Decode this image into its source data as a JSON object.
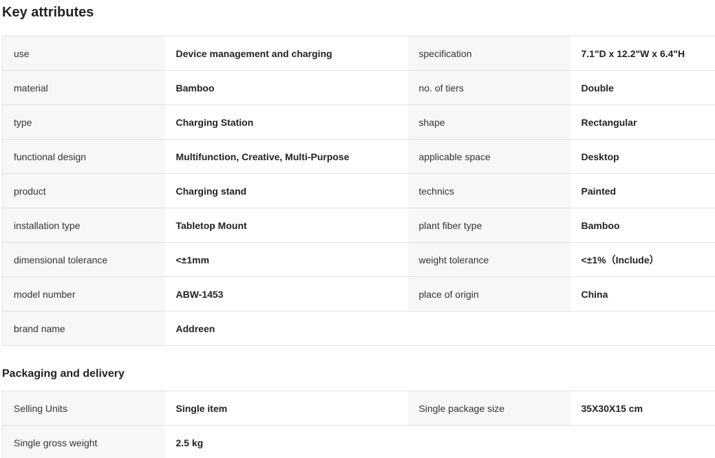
{
  "key_attributes": {
    "title": "Key attributes",
    "rows": [
      [
        {
          "name": "use",
          "value": "Device management and charging"
        },
        {
          "name": "specification",
          "value": "7.1\"D x 12.2\"W x 6.4\"H"
        }
      ],
      [
        {
          "name": "material",
          "value": "Bamboo"
        },
        {
          "name": "no. of tiers",
          "value": "Double"
        }
      ],
      [
        {
          "name": "type",
          "value": "Charging Station"
        },
        {
          "name": "shape",
          "value": "Rectangular"
        }
      ],
      [
        {
          "name": "functional design",
          "value": "Multifunction, Creative, Multi-Purpose"
        },
        {
          "name": "applicable space",
          "value": "Desktop"
        }
      ],
      [
        {
          "name": "product",
          "value": "Charging stand"
        },
        {
          "name": "technics",
          "value": "Painted"
        }
      ],
      [
        {
          "name": "installation type",
          "value": "Tabletop Mount"
        },
        {
          "name": "plant fiber type",
          "value": "Bamboo"
        }
      ],
      [
        {
          "name": "dimensional tolerance",
          "value": "<±1mm"
        },
        {
          "name": "weight tolerance",
          "value": "<±1%（Include）"
        }
      ],
      [
        {
          "name": "model number",
          "value": "ABW-1453"
        },
        {
          "name": "place of origin",
          "value": "China"
        }
      ],
      [
        {
          "name": "brand name",
          "value": "Addreen"
        }
      ]
    ]
  },
  "packaging": {
    "title": "Packaging and delivery",
    "rows": [
      [
        {
          "name": "Selling Units",
          "value": "Single item"
        },
        {
          "name": "Single package size",
          "value": "35X30X15 cm"
        }
      ],
      [
        {
          "name": "Single gross weight",
          "value": "2.5 kg"
        }
      ]
    ]
  },
  "colors": {
    "label_bg": "#f7f7f7",
    "value_bg": "#ffffff",
    "border": "#e2e2e2",
    "text": "#222222"
  }
}
